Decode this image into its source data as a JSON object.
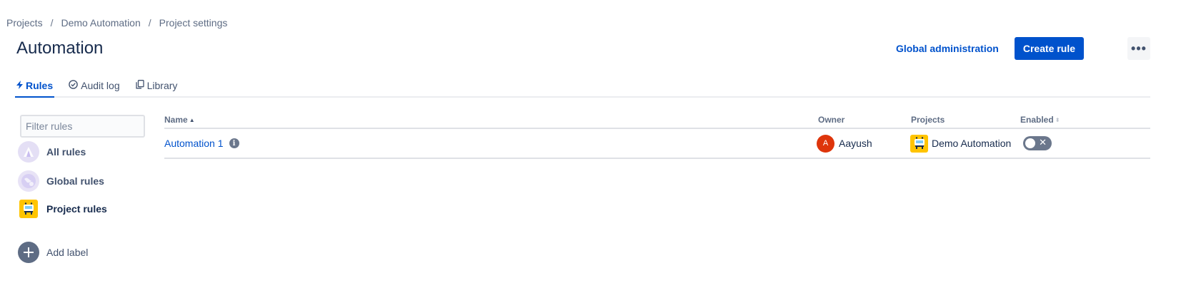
{
  "breadcrumb": {
    "items": [
      "Projects",
      "Demo Automation",
      "Project settings"
    ],
    "separator": "/"
  },
  "page": {
    "title": "Automation"
  },
  "header_actions": {
    "global_admin_label": "Global administration",
    "create_rule_label": "Create rule",
    "more_label": "•••"
  },
  "tabs": [
    {
      "label": "Rules",
      "icon": "lightning-icon",
      "active": true
    },
    {
      "label": "Audit log",
      "icon": "check-circle-icon",
      "active": false
    },
    {
      "label": "Library",
      "icon": "copy-icon",
      "active": false
    }
  ],
  "sidebar": {
    "filter_placeholder": "Filter rules",
    "items": [
      {
        "label": "All rules",
        "icon": "all-rules-icon",
        "active": false
      },
      {
        "label": "Global rules",
        "icon": "globe-icon",
        "active": false
      },
      {
        "label": "Project rules",
        "icon": "project-icon",
        "active": true
      }
    ],
    "add_label": "Add label"
  },
  "table": {
    "columns": {
      "name": "Name",
      "owner": "Owner",
      "projects": "Projects",
      "enabled": "Enabled"
    },
    "rows": [
      {
        "name": "Automation 1",
        "owner": "Aayush",
        "owner_initial": "A",
        "project": "Demo Automation",
        "enabled": false
      }
    ]
  },
  "colors": {
    "primary": "#0052cc",
    "text": "#172b4d",
    "muted": "#5e6c84",
    "avatar_owner": "#de350b",
    "project_avatar": "#ffc400",
    "toggle_off": "#6b778c"
  }
}
